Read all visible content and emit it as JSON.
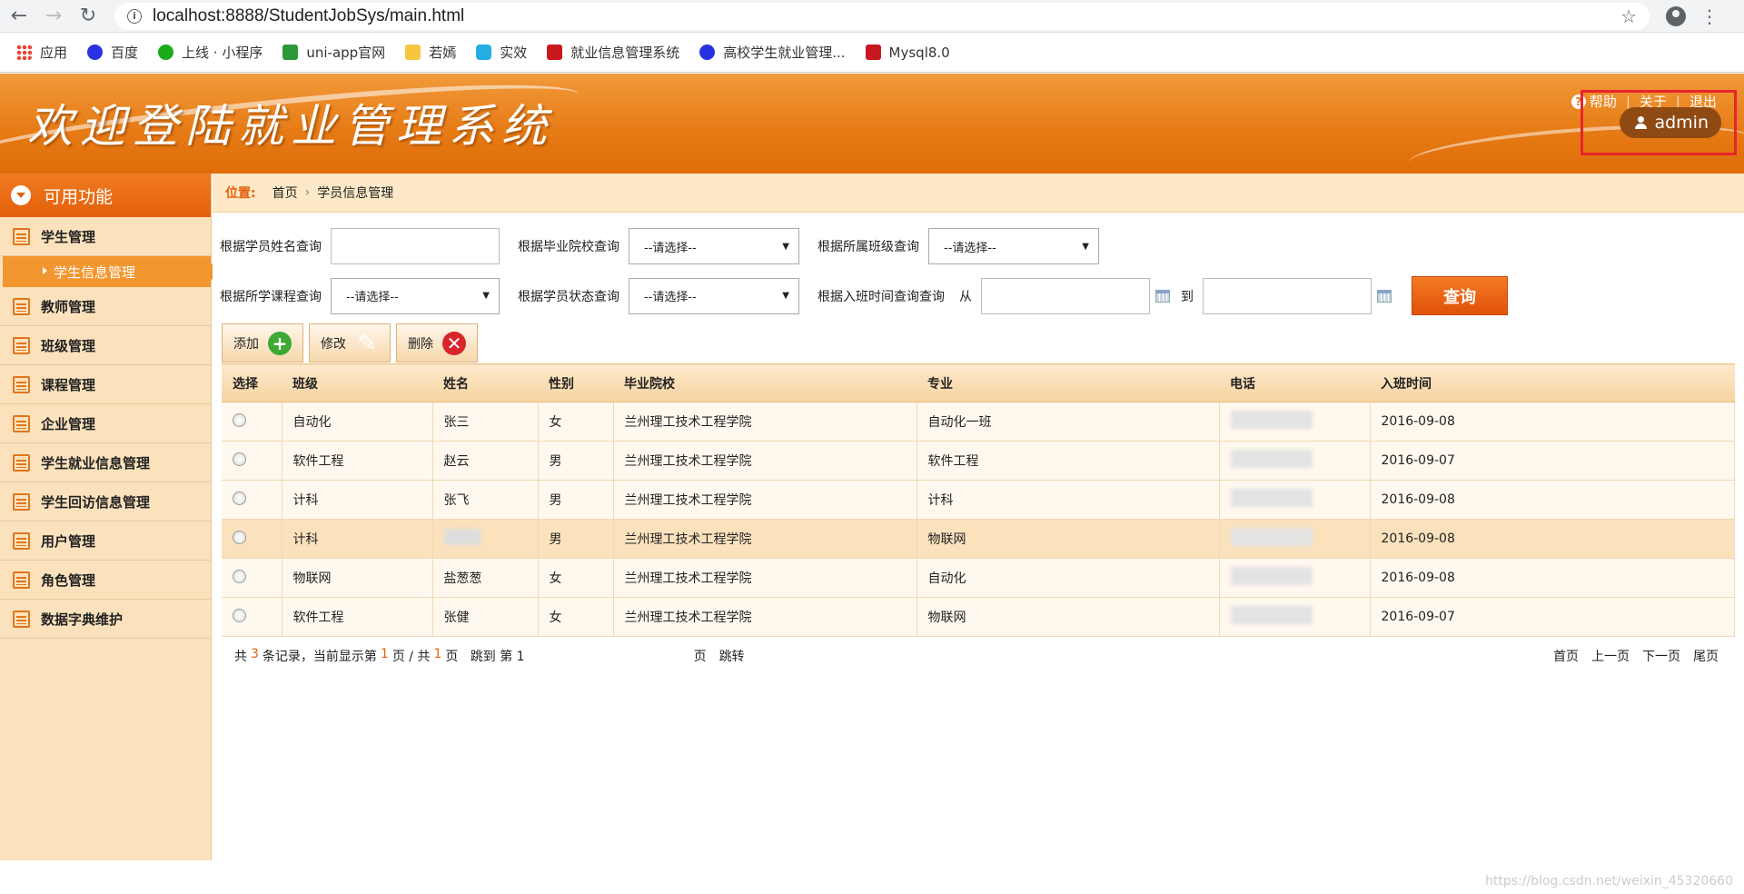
{
  "browser": {
    "url": "localhost:8888/StudentJobSys/main.html",
    "bookmarks": [
      "应用",
      "百度",
      "上线 · 小程序",
      "uni-app官网",
      "若嫣",
      "实效",
      "就业信息管理系统",
      "高校学生就业管理...",
      "Mysql8.0"
    ]
  },
  "header": {
    "title": "欢迎登陆就业管理系统",
    "links": [
      "帮助",
      "关于",
      "退出"
    ],
    "user": "admin"
  },
  "sidebar": {
    "heading": "可用功能",
    "items": [
      "学生管理",
      "教师管理",
      "班级管理",
      "课程管理",
      "企业管理",
      "学生就业信息管理",
      "学生回访信息管理",
      "用户管理",
      "角色管理",
      "数据字典维护"
    ],
    "sub_item": "学生信息管理"
  },
  "breadcrumb": {
    "label": "位置:",
    "home": "首页",
    "current": "学员信息管理"
  },
  "search": {
    "name_label": "根据学员姓名查询",
    "school_label": "根据毕业院校查询",
    "class_label": "根据所属班级查询",
    "course_label": "根据所学课程查询",
    "status_label": "根据学员状态查询",
    "time_label": "根据入班时间查询查询",
    "from": "从",
    "to": "到",
    "select_default": "--请选择--",
    "query_button": "查询"
  },
  "toolbar": {
    "add": "添加",
    "edit": "修改",
    "delete": "删除"
  },
  "table": {
    "headers": [
      "选择",
      "班级",
      "姓名",
      "性别",
      "毕业院校",
      "专业",
      "电话",
      "入班时间"
    ],
    "rows": [
      [
        "自动化",
        "张三",
        "女",
        "兰州理工技术工程学院",
        "自动化一班",
        "2016-09-08"
      ],
      [
        "软件工程",
        "赵云",
        "男",
        "兰州理工技术工程学院",
        "软件工程",
        "2016-09-07"
      ],
      [
        "计科",
        "张飞",
        "男",
        "兰州理工技术工程学院",
        "计科",
        "2016-09-08"
      ],
      [
        "计科",
        "",
        "男",
        "兰州理工技术工程学院",
        "物联网",
        "2016-09-08"
      ],
      [
        "物联网",
        "盐葱葱",
        "女",
        "兰州理工技术工程学院",
        "自动化",
        "2016-09-08"
      ],
      [
        "软件工程",
        "张健",
        "女",
        "兰州理工技术工程学院",
        "物联网",
        "2016-09-07"
      ]
    ]
  },
  "pager": {
    "p1": "共",
    "count": "3",
    "p2": "条记录，当前显示第",
    "page": "1",
    "p3": "页 / 共",
    "total": "1",
    "p4": "页   跳到 第 1",
    "page_unit": "页",
    "jump": "跳转",
    "first": "首页",
    "prev": "上一页",
    "next": "下一页",
    "last": "尾页"
  },
  "watermark": "https://blog.csdn.net/weixin_45320660"
}
